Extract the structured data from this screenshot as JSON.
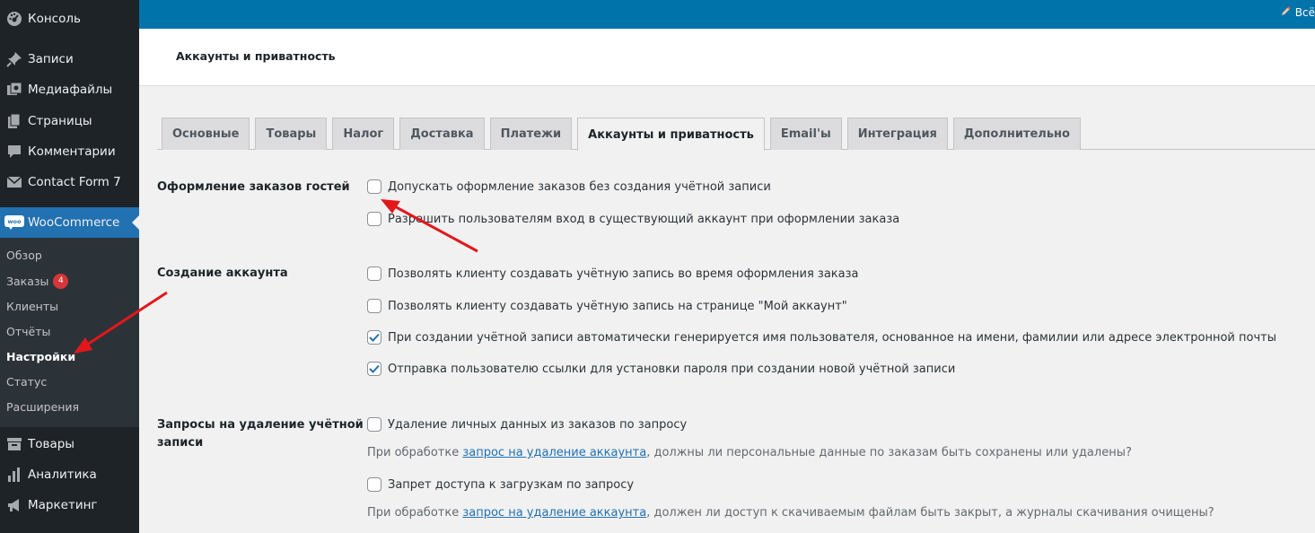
{
  "sidebar": {
    "items": [
      {
        "label": "Консоль",
        "icon": "dashboard-icon"
      },
      {
        "label": "Записи",
        "icon": "pin-icon"
      },
      {
        "label": "Медиафайлы",
        "icon": "media-icon"
      },
      {
        "label": "Страницы",
        "icon": "pages-icon"
      },
      {
        "label": "Комментарии",
        "icon": "comment-icon"
      },
      {
        "label": "Contact Form 7",
        "icon": "mail-icon"
      },
      {
        "label": "WooCommerce",
        "icon": "woo-icon"
      },
      {
        "label": "Товары",
        "icon": "archive-icon"
      },
      {
        "label": "Аналитика",
        "icon": "chart-icon"
      },
      {
        "label": "Маркетинг",
        "icon": "megaphone-icon"
      }
    ],
    "woo_badge": "woo",
    "submenu": [
      {
        "label": "Обзор"
      },
      {
        "label": "Заказы",
        "badge": "4"
      },
      {
        "label": "Клиенты"
      },
      {
        "label": "Отчёты"
      },
      {
        "label": "Настройки"
      },
      {
        "label": "Статус"
      },
      {
        "label": "Расширения"
      }
    ]
  },
  "topbar": {
    "right_label": "Всё"
  },
  "header": {
    "title": "Аккаунты и приватность"
  },
  "tabs": [
    {
      "label": "Основные"
    },
    {
      "label": "Товары"
    },
    {
      "label": "Налог"
    },
    {
      "label": "Доставка"
    },
    {
      "label": "Платежи"
    },
    {
      "label": "Аккаунты и приватность",
      "active": true
    },
    {
      "label": "Email'ы"
    },
    {
      "label": "Интеграция"
    },
    {
      "label": "Дополнительно"
    }
  ],
  "sections": {
    "guest": {
      "label": "Оформление заказов гостей",
      "options": [
        {
          "label": "Допускать оформление заказов без создания учётной записи",
          "checked": false
        },
        {
          "label": "Разрешить пользователям вход в существующий аккаунт при оформлении заказа",
          "checked": false
        }
      ]
    },
    "account": {
      "label": "Создание аккаунта",
      "options": [
        {
          "label": "Позволять клиенту создавать учётную запись во время оформления заказа",
          "checked": false
        },
        {
          "label": "Позволять клиенту создавать учётную запись на странице \"Мой аккаунт\"",
          "checked": false
        },
        {
          "label": "При создании учётной записи автоматически генерируется имя пользователя, основанное на имени, фамилии или адресе электронной почты",
          "checked": true
        },
        {
          "label": "Отправка пользователю ссылки для установки пароля при создании новой учётной записи",
          "checked": true
        }
      ]
    },
    "erasure": {
      "label_line1": "Запросы на удаление учётной",
      "label_line2": "записи",
      "options": [
        {
          "label": "Удаление личных данных из заказов по запросу",
          "checked": false
        },
        {
          "label": "Запрет доступа к загрузкам по запросу",
          "checked": false
        }
      ],
      "desc1": {
        "before": "При обработке ",
        "link": "запрос на удаление аккаунта",
        "after": ", должны ли персональные данные по заказам быть сохранены или удалены?"
      },
      "desc2": {
        "before": "При обработке ",
        "link": "запрос на удаление аккаунта",
        "after": ", должен ли доступ к скачиваемым файлам быть закрыт, а журналы скачивания очищены?"
      }
    }
  },
  "colors": {
    "sidebar": "#1d2327",
    "submenu": "#2c3338",
    "accent": "#2271b1",
    "topbar": "#0073aa",
    "arrow": "#e3171b",
    "checkmark": "#2271b1"
  }
}
